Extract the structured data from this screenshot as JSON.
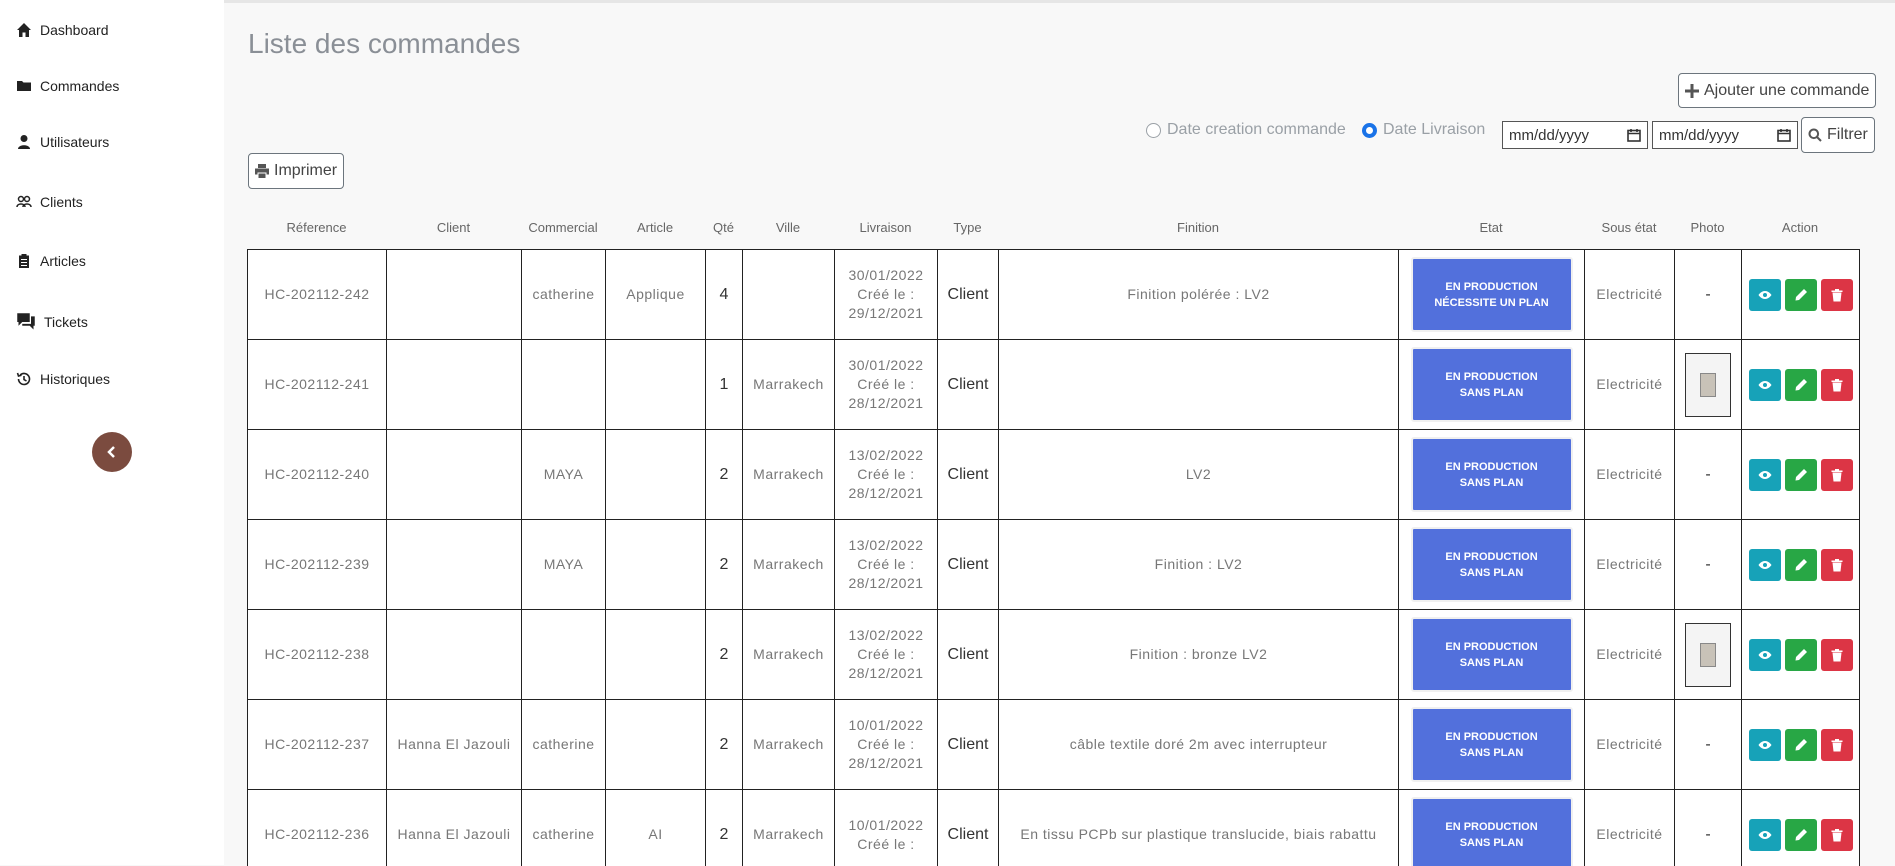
{
  "sidebar": {
    "items": [
      {
        "label": "Dashboard",
        "icon": "home-icon"
      },
      {
        "label": "Commandes",
        "icon": "folder-icon"
      },
      {
        "label": "Utilisateurs",
        "icon": "user-icon"
      },
      {
        "label": "Clients",
        "icon": "users-icon"
      },
      {
        "label": "Articles",
        "icon": "clipboard-icon"
      },
      {
        "label": "Tickets",
        "icon": "chat-icon"
      },
      {
        "label": "Historiques",
        "icon": "history-icon"
      }
    ],
    "collapse_icon": "chevron-left-icon"
  },
  "page": {
    "title": "Liste des commandes",
    "add_button": "Ajouter une commande",
    "print_button": "Imprimer",
    "filter_button": "Filtrer",
    "radio_creation": "Date creation commande",
    "radio_livraison": "Date Livraison",
    "selected_radio": "livraison",
    "date_from_placeholder": "mm/dd/yyyy",
    "date_to_placeholder": "mm/dd/yyyy"
  },
  "table": {
    "headers": [
      "Réference",
      "Client",
      "Commercial",
      "Article",
      "Qté",
      "Ville",
      "Livraison",
      "Type",
      "Finition",
      "Etat",
      "Sous état",
      "Photo",
      "Action"
    ],
    "rows": [
      {
        "ref": "HC-202112-242",
        "client": "",
        "commercial": "catherine",
        "article": "Applique",
        "qte": "4",
        "ville": "",
        "livraison": [
          "30/01/2022",
          "Créé le :",
          "29/12/2021"
        ],
        "type": "Client",
        "finition": "Finition polérée : LV2",
        "etat": [
          "EN PRODUCTION",
          "NÉCESSITE UN PLAN"
        ],
        "sous_etat": "Electricité",
        "photo": "-"
      },
      {
        "ref": "HC-202112-241",
        "client": "",
        "commercial": "",
        "article": "",
        "qte": "1",
        "ville": "Marrakech",
        "livraison": [
          "30/01/2022",
          "Créé le :",
          "28/12/2021"
        ],
        "type": "Client",
        "finition": "",
        "etat": [
          "EN PRODUCTION",
          "SANS PLAN"
        ],
        "sous_etat": "Electricité",
        "photo": "image"
      },
      {
        "ref": "HC-202112-240",
        "client": "",
        "commercial": "MAYA",
        "article": "",
        "qte": "2",
        "ville": "Marrakech",
        "livraison": [
          "13/02/2022",
          "Créé le :",
          "28/12/2021"
        ],
        "type": "Client",
        "finition": "LV2",
        "etat": [
          "EN PRODUCTION",
          "SANS PLAN"
        ],
        "sous_etat": "Electricité",
        "photo": "-"
      },
      {
        "ref": "HC-202112-239",
        "client": "",
        "commercial": "MAYA",
        "article": "",
        "qte": "2",
        "ville": "Marrakech",
        "livraison": [
          "13/02/2022",
          "Créé le :",
          "28/12/2021"
        ],
        "type": "Client",
        "finition": "Finition : LV2",
        "etat": [
          "EN PRODUCTION",
          "SANS PLAN"
        ],
        "sous_etat": "Electricité",
        "photo": "-"
      },
      {
        "ref": "HC-202112-238",
        "client": "",
        "commercial": "",
        "article": "",
        "qte": "2",
        "ville": "Marrakech",
        "livraison": [
          "13/02/2022",
          "Créé le :",
          "28/12/2021"
        ],
        "type": "Client",
        "finition": "Finition : bronze LV2",
        "etat": [
          "EN PRODUCTION",
          "SANS PLAN"
        ],
        "sous_etat": "Electricité",
        "photo": "image"
      },
      {
        "ref": "HC-202112-237",
        "client": "Hanna El Jazouli",
        "commercial": "catherine",
        "article": "",
        "qte": "2",
        "ville": "Marrakech",
        "livraison": [
          "10/01/2022",
          "Créé le :",
          "28/12/2021"
        ],
        "type": "Client",
        "finition": "câble textile doré 2m avec interrupteur",
        "etat": [
          "EN PRODUCTION",
          "SANS PLAN"
        ],
        "sous_etat": "Electricité",
        "photo": "-"
      },
      {
        "ref": "HC-202112-236",
        "client": "Hanna El Jazouli",
        "commercial": "catherine",
        "article": "AI",
        "qte": "2",
        "ville": "Marrakech",
        "livraison": [
          "10/01/2022",
          "Créé le :",
          ""
        ],
        "type": "Client",
        "finition": "En tissu PCPb sur plastique translucide, biais rabattu",
        "etat": [
          "EN PRODUCTION",
          "SANS PLAN"
        ],
        "sous_etat": "Electricité",
        "photo": "-"
      }
    ]
  },
  "colors": {
    "etat_bg": "#5270dc",
    "view": "#17a2b8",
    "edit": "#28a745",
    "delete": "#dc3545",
    "collapse": "#7b4b3f",
    "radio_active": "#1a73e8"
  }
}
